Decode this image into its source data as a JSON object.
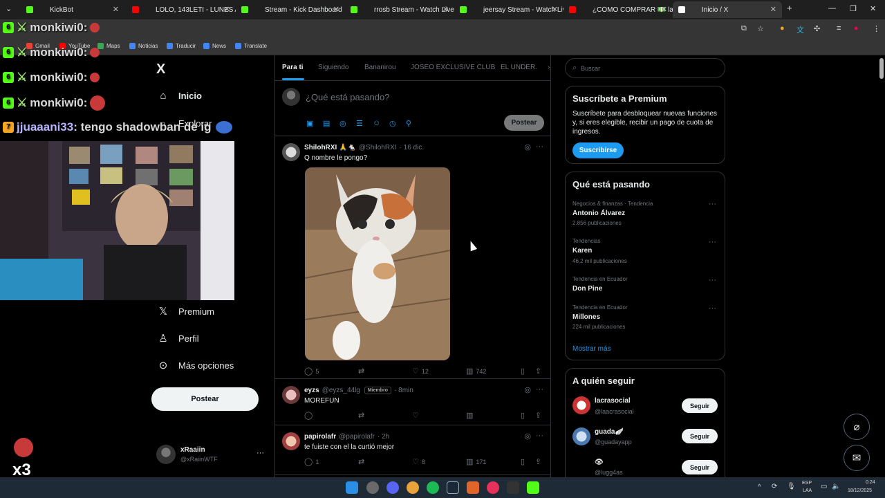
{
  "browser": {
    "tabs": [
      {
        "label": "KickBot",
        "fav": "#53fc18"
      },
      {
        "label": "LOLO, 143LETI - LUNES A VIERNES",
        "fav": "#ff0000"
      },
      {
        "label": "Stream - Kick Dashboard",
        "fav": "#53fc18"
      },
      {
        "label": "rrosb Stream - Watch Live on K",
        "fav": "#53fc18"
      },
      {
        "label": "jeersay Stream - Watch Live on",
        "fav": "#53fc18"
      },
      {
        "label": "¿CÓMO COMPRAR 💵 las CA...",
        "fav": "#ff0000"
      },
      {
        "label": "Inicio / X",
        "fav": "#ffffff"
      }
    ],
    "new_tab": "+",
    "bookmarks": [
      "Gmail",
      "YouTube",
      "Maps",
      "Noticias",
      "Traducir",
      "News",
      "Translate"
    ]
  },
  "stream": {
    "chat": [
      {
        "user": "monkiwi0:",
        "msg": ""
      },
      {
        "user": "monkiwi0:",
        "msg": ""
      },
      {
        "user": "monkiwi0:",
        "msg": ""
      },
      {
        "user": "monkiwi0:",
        "msg": ""
      },
      {
        "user": "jjuaaani33",
        "msg": ": tengo shadowban de ig"
      }
    ],
    "combo": "x3"
  },
  "nav": {
    "logo": "X",
    "inicio": "Inicio",
    "explorar": "Explorar",
    "premium": "Premium",
    "perfil": "Perfil",
    "mas": "Más opciones",
    "post": "Postear",
    "account_name": "xRaaiin",
    "account_handle": "@xRaiinWTF"
  },
  "timeline": {
    "tabs": [
      "Para ti",
      "Siguiendo",
      "Bananirou",
      "JOSEO EXCLUSIVE CLUB",
      "EL UNDER."
    ],
    "composer_placeholder": "¿Qué está pasando?",
    "composer_post": "Postear",
    "tweets": [
      {
        "name": "ShilohRXI 🙏🐁",
        "handle": "@ShilohRXI",
        "time": "· 16 dic.",
        "text": "Q nombre le pongo?",
        "replies": "5",
        "reposts": "",
        "likes": "12",
        "views": "742"
      },
      {
        "name": "eyzs",
        "handle": "@eyzs_44lg",
        "badge": "Miembro",
        "time": "· 8min",
        "text": "MOREFUN",
        "replies": "",
        "reposts": "",
        "likes": "",
        "views": ""
      },
      {
        "name": "papirolafr",
        "handle": "@papirolafr",
        "time": "· 2h",
        "text": "te fuiste con el la curtió mejor",
        "replies": "1",
        "reposts": "",
        "likes": "8",
        "views": "171"
      }
    ]
  },
  "sidebar": {
    "search_placeholder": "Buscar",
    "premium": {
      "title": "Suscríbete a Premium",
      "body": "Suscríbete para desbloquear nuevas funciones y, si eres elegible, recibir un pago de cuota de ingresos.",
      "button": "Suscribirse"
    },
    "trends_title": "Qué está pasando",
    "trends": [
      {
        "cat": "Negocios & finanzas · Tendencia",
        "name": "Antonio Álvarez",
        "count": "2.856 publicaciones"
      },
      {
        "cat": "Tendencias",
        "name": "Karen",
        "count": "46,2 mil publicaciones"
      },
      {
        "cat": "Tendencia en Ecuador",
        "name": "Don Pine",
        "count": ""
      },
      {
        "cat": "Tendencia en Ecuador",
        "name": "Millones",
        "count": "224 mil publicaciones"
      }
    ],
    "show_more": "Mostrar más",
    "follow_title": "A quién seguir",
    "follow": [
      {
        "name": "lacrasocial",
        "handle": "@laacrasocial",
        "button": "Seguir"
      },
      {
        "name": "guada🪽",
        "handle": "@guadayapp",
        "button": "Seguir"
      },
      {
        "name": "👁",
        "handle": "@lugg4as",
        "button": "Seguir"
      }
    ]
  },
  "taskbar": {
    "lang1": "ESP",
    "lang2": "LAA",
    "time": "0:24",
    "date": "18/12/2025"
  },
  "colors": {
    "accent": "#1d9bf0",
    "kick_green": "#53fc18",
    "bg": "#000000"
  }
}
